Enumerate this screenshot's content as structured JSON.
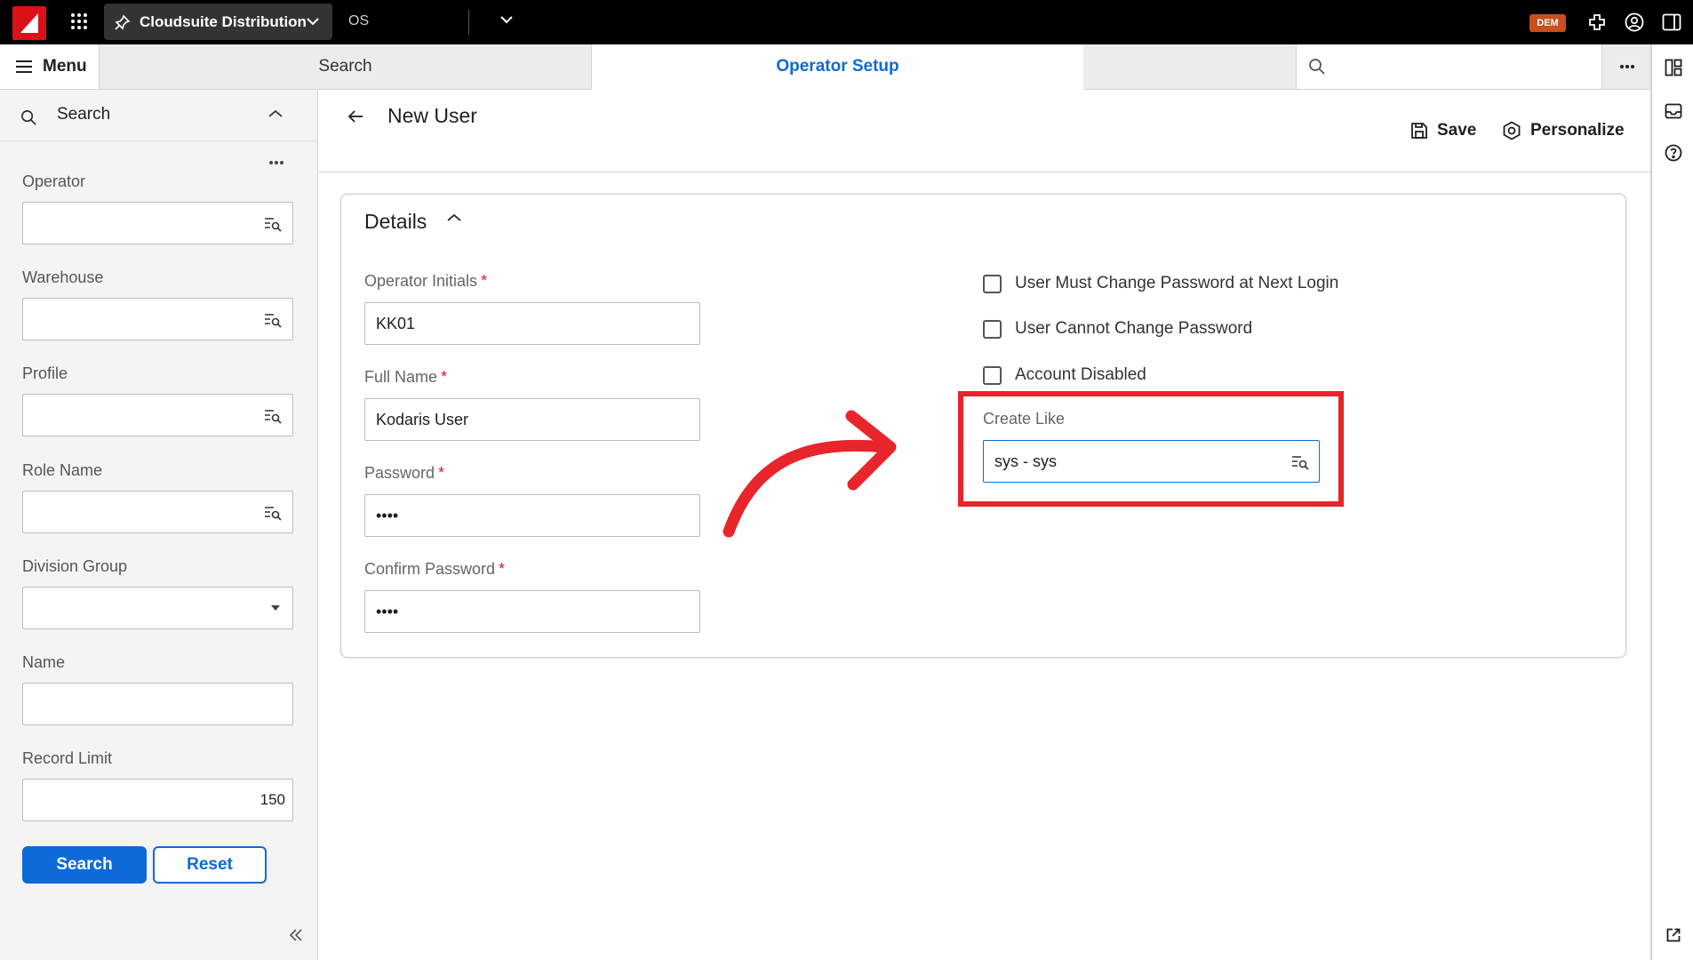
{
  "topbar": {
    "workspace": "Cloudsuite Distribution",
    "context": "OS",
    "badge": "DEM"
  },
  "tabs": {
    "menu": "Menu",
    "search": "Search",
    "active": "Operator Setup",
    "search_placeholder": ""
  },
  "left_panel": {
    "header": "Search",
    "fields": [
      {
        "label": "Operator",
        "value": ""
      },
      {
        "label": "Warehouse",
        "value": ""
      },
      {
        "label": "Profile",
        "value": ""
      },
      {
        "label": "Role Name",
        "value": ""
      },
      {
        "label": "Division Group",
        "value": ""
      },
      {
        "label": "Name",
        "value": ""
      },
      {
        "label": "Record Limit",
        "value": "150"
      }
    ],
    "search_button": "Search",
    "reset_button": "Reset"
  },
  "main": {
    "title": "New User",
    "save_label": "Save",
    "personalize_label": "Personalize",
    "section_title": "Details",
    "required_mark": "*",
    "fields": [
      {
        "label": "Operator Initials",
        "value": "KK01"
      },
      {
        "label": "Full Name",
        "value": "Kodaris User"
      },
      {
        "label": "Password",
        "value": "••••"
      },
      {
        "label": "Confirm Password",
        "value": "••••"
      }
    ],
    "checkboxes": [
      {
        "label": "User Must Change Password at Next Login",
        "checked": false
      },
      {
        "label": "User Cannot Change Password",
        "checked": false
      },
      {
        "label": "Account Disabled",
        "checked": false
      }
    ],
    "create_like": {
      "label": "Create Like",
      "value": "sys - sys"
    }
  },
  "colors": {
    "accent": "#0d6ad8",
    "brand": "#da1217",
    "annotation": "#e8252a",
    "badge": "#c7501e"
  },
  "icons": [
    "logo-icon",
    "apps-grid-icon",
    "pin-icon",
    "chevron-down-icon",
    "plugin-icon",
    "user-circle-icon",
    "panel-toggle-icon",
    "hamburger-icon",
    "search-icon",
    "more-horizontal-icon",
    "layout-icon",
    "inbox-icon",
    "help-icon",
    "external-link-icon",
    "chevron-up-icon",
    "lookup-icon",
    "dropdown-caret-icon",
    "double-chevron-left-icon",
    "back-arrow-icon",
    "save-icon",
    "personalize-icon",
    "curved-arrow-icon"
  ]
}
